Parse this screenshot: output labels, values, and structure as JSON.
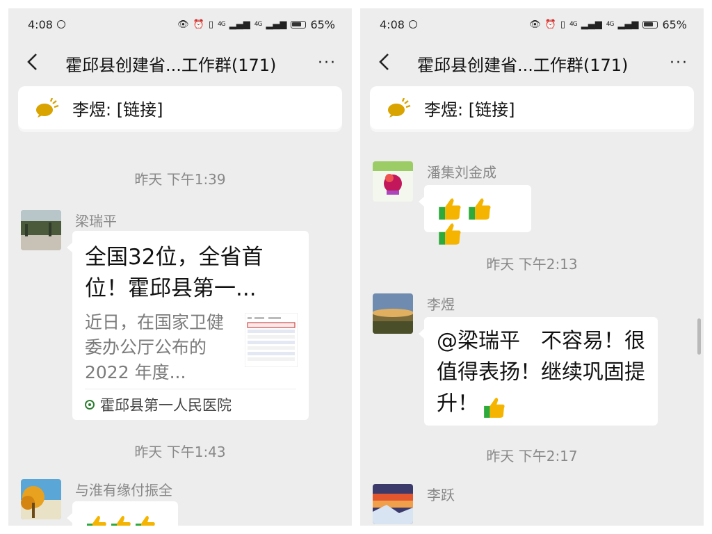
{
  "status_bar": {
    "time": "4:08",
    "network_1": "4G",
    "network_2": "4G",
    "battery": "65%"
  },
  "chat": {
    "title": "霍邱县创建省...工作群(171)",
    "more_label": "···",
    "pinned_notice": "李煜: [链接]"
  },
  "left_panel": {
    "divider_1": "昨天 下午1:39",
    "msg_1": {
      "sender": "梁瑞平",
      "link_title": "全国32位，全省首位！霍邱县第一...",
      "link_desc": "近日，在国家卫健委办公厅公布的2022 年度...",
      "link_source": "霍邱县第一人民医院"
    },
    "divider_2": "昨天 下午1:43",
    "msg_2": {
      "sender": "与淮有缘付振全"
    }
  },
  "right_panel": {
    "msg_1": {
      "sender": "潘集刘金成",
      "thumbs_count": 3
    },
    "divider_1": "昨天 下午2:13",
    "msg_2": {
      "sender": "李煜",
      "text": "@梁瑞平　不容易！很值得表扬！继续巩固提升！"
    },
    "divider_2": "昨天 下午2:17",
    "msg_3": {
      "sender": "李跃"
    }
  },
  "colors": {
    "chat_bg": "#ededed",
    "bubble_bg": "#ffffff",
    "meta_text": "#888888",
    "thumbs_up": "#f5b400",
    "thumbs_cuff": "#2eaa3c",
    "notice_icon": "#d9a300"
  }
}
